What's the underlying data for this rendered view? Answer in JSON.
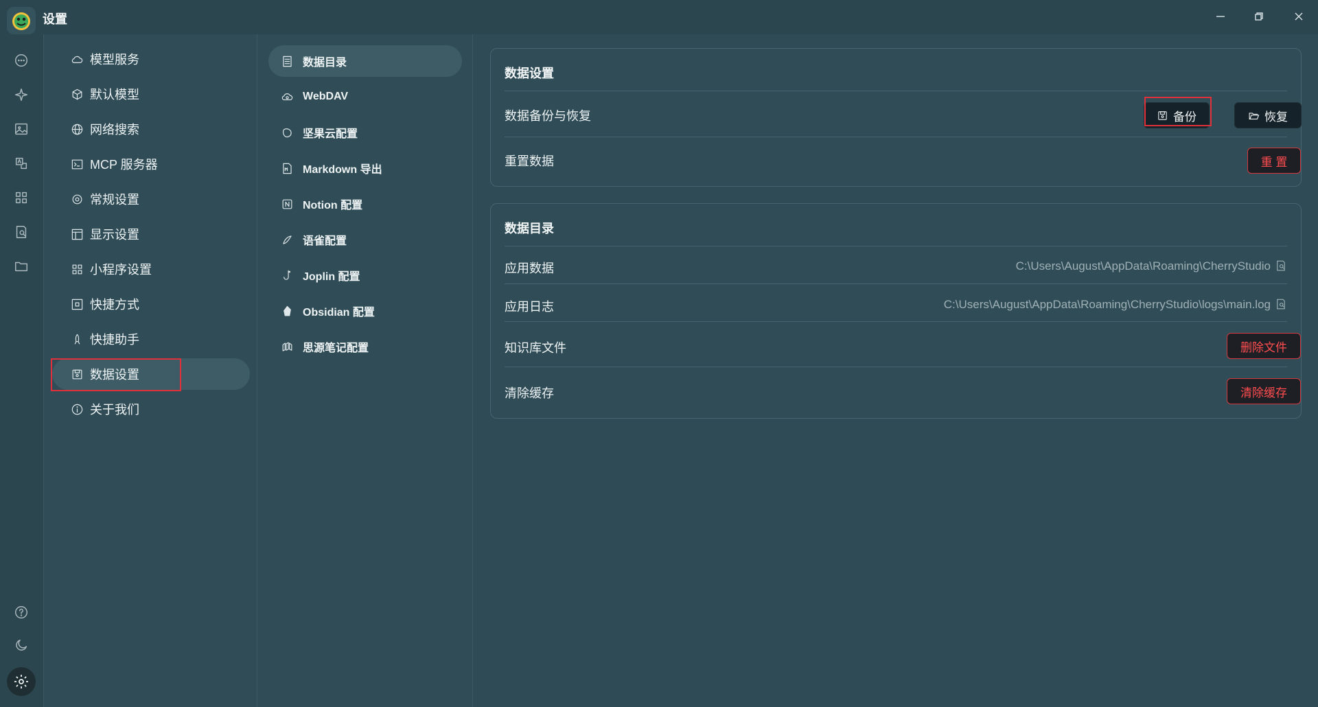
{
  "app": {
    "title": "设置"
  },
  "rail": {
    "icons": [
      "chat-icon",
      "sparkle-icon",
      "image-icon",
      "translate-icon",
      "apps-icon",
      "knowledge-icon",
      "folder-icon",
      "help-icon",
      "moon-icon",
      "settings-icon"
    ]
  },
  "menu1": {
    "items": [
      {
        "label": "模型服务",
        "icon": "cloud-icon"
      },
      {
        "label": "默认模型",
        "icon": "cube-icon"
      },
      {
        "label": "网络搜索",
        "icon": "globe-icon"
      },
      {
        "label": "MCP 服务器",
        "icon": "terminal-icon"
      },
      {
        "label": "常规设置",
        "icon": "gear-icon"
      },
      {
        "label": "显示设置",
        "icon": "layout-icon"
      },
      {
        "label": "小程序设置",
        "icon": "grid-icon"
      },
      {
        "label": "快捷方式",
        "icon": "command-icon"
      },
      {
        "label": "快捷助手",
        "icon": "rocket-icon"
      },
      {
        "label": "数据设置",
        "icon": "save-icon",
        "active": true
      },
      {
        "label": "关于我们",
        "icon": "info-icon"
      }
    ]
  },
  "menu2": {
    "items": [
      {
        "label": "数据目录",
        "icon": "document-icon",
        "active": true
      },
      {
        "label": "WebDAV",
        "icon": "cloud-sync-icon"
      },
      {
        "label": "坚果云配置",
        "icon": "nut-icon"
      },
      {
        "label": "Markdown 导出",
        "icon": "markdown-icon"
      },
      {
        "label": "Notion 配置",
        "icon": "notion-icon"
      },
      {
        "label": "语雀配置",
        "icon": "yuque-icon"
      },
      {
        "label": "Joplin 配置",
        "icon": "joplin-icon"
      },
      {
        "label": "Obsidian 配置",
        "icon": "obsidian-icon"
      },
      {
        "label": "思源笔记配置",
        "icon": "siyuan-icon"
      }
    ]
  },
  "data_settings": {
    "title": "数据设置",
    "backup_label": "数据备份与恢复",
    "backup_button": "备份",
    "restore_button": "恢复",
    "reset_label": "重置数据",
    "reset_button": "重 置"
  },
  "data_dir": {
    "title": "数据目录",
    "app_data_label": "应用数据",
    "app_data_path": "C:\\Users\\August\\AppData\\Roaming\\CherryStudio",
    "app_log_label": "应用日志",
    "app_log_path": "C:\\Users\\August\\AppData\\Roaming\\CherryStudio\\logs\\main.log",
    "kb_label": "知识库文件",
    "kb_button": "删除文件",
    "cache_label": "清除缓存",
    "cache_button": "清除缓存"
  },
  "colors": {
    "accent_danger": "#ff4d4f",
    "highlight_box": "#e0303a",
    "background": "#2f4b55"
  }
}
